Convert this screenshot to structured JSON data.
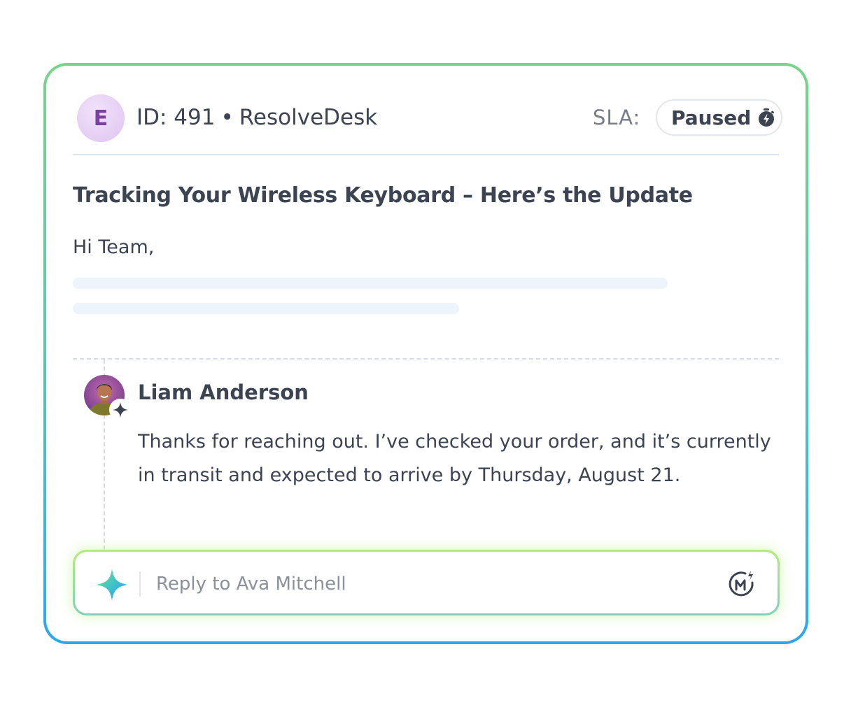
{
  "header": {
    "avatar_letter": "E",
    "ticket_id": "ID: 491",
    "separator": "•",
    "desk_name": "ResolveDesk",
    "sla_label": "SLA:",
    "sla_status": "Paused",
    "sla_icon": "paused-timer-icon"
  },
  "email": {
    "subject": "Tracking Your Wireless Keyboard – Here’s the Update",
    "greeting": "Hi Team,"
  },
  "reply": {
    "agent_name": "Liam Anderson",
    "agent_icon": "ai-sparkle-badge-icon",
    "message": "Thanks for reaching out. I’ve checked your order, and it’s currently in transit and expected to arrive by Thursday, August 21."
  },
  "composer": {
    "placeholder": "Reply to Ava Mitchell",
    "left_icon": "sparkle-icon",
    "right_icon": "ai-assist-icon"
  },
  "colors": {
    "text_primary": "#3c4452",
    "border_gradient_top": "#78d489",
    "border_gradient_bottom": "#2aa8ef",
    "avatar_bg": "#e4cdf3",
    "avatar_letter": "#7b3fa0"
  }
}
